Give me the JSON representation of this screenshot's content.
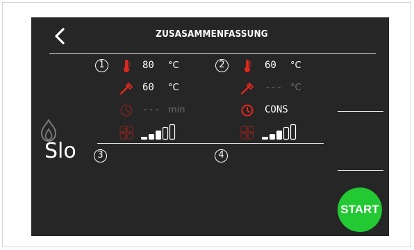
{
  "header": {
    "title": "ZUSASAMMENFASSUNG",
    "back_icon": "chevron-left-icon"
  },
  "colors": {
    "background": "#262626",
    "icon_red": "#e0271e",
    "icon_red_dim": "#6a2420",
    "text_dim": "#6e6e6e",
    "start_green": "#22c933"
  },
  "zones": [
    {
      "number": "1",
      "temperature": {
        "value": "80",
        "unit": "°C",
        "icon": "thermometer-icon"
      },
      "probe": {
        "value": "60",
        "unit": "°C",
        "icon": "probe-icon"
      },
      "time": {
        "value": "---",
        "unit": "min",
        "icon": "timer-icon",
        "active": false
      },
      "fan": {
        "level": 3,
        "max": 5,
        "icon": "fan-icon"
      }
    },
    {
      "number": "2",
      "temperature": {
        "value": "60",
        "unit": "°C",
        "icon": "thermometer-icon"
      },
      "probe": {
        "value": "---",
        "unit": "°C",
        "icon": "probe-icon",
        "active": false
      },
      "time": {
        "value": "CONS",
        "unit": "",
        "icon": "timer-icon",
        "active": true
      },
      "fan": {
        "level": 3,
        "max": 5,
        "icon": "fan-icon"
      }
    },
    {
      "number": "3"
    },
    {
      "number": "4"
    }
  ],
  "mode": {
    "label": "Slo",
    "icon": "flame-icon"
  },
  "actions": {
    "start_label": "START"
  }
}
